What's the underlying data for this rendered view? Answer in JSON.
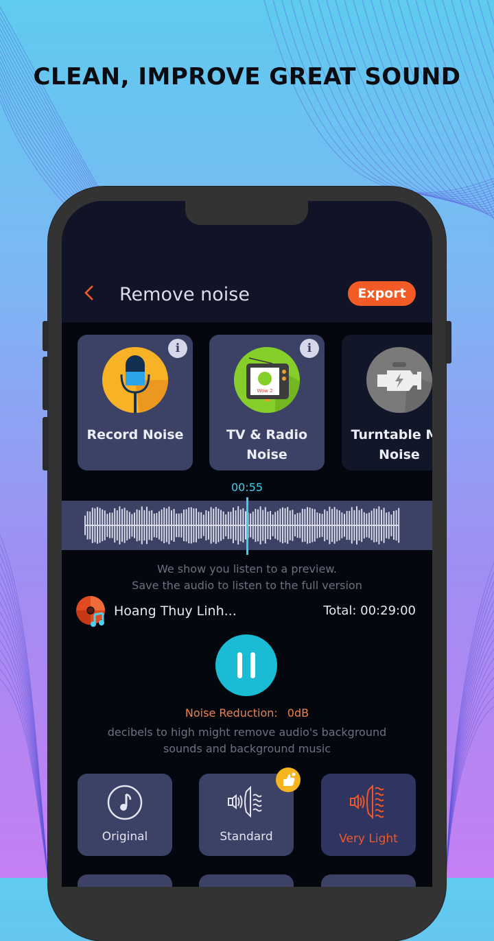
{
  "promo": {
    "headline": "CLEAN, IMPROVE GREAT SOUND"
  },
  "header": {
    "title": "Remove noise",
    "back_icon": "chevron-left-icon",
    "export_label": "Export"
  },
  "noise_types": [
    {
      "label": "Record Noise",
      "icon": "microphone-icon",
      "has_info": true
    },
    {
      "label": "TV & Radio\nNoise",
      "icon": "tv-icon",
      "has_info": true
    },
    {
      "label": "Turntable Mo\nNoise",
      "icon": "engine-icon",
      "has_info": false
    }
  ],
  "player": {
    "current_time": "00:55",
    "preview_hint_line1": "We show you listen to a preview.",
    "preview_hint_line2": "Save the audio to listen to the full version",
    "track_name": "Hoang Thuy Linh...",
    "total_label": "Total: 00:29:00",
    "pause_icon": "pause-icon",
    "progress_fraction": 0.5
  },
  "noise_reduction": {
    "label": "Noise Reduction:",
    "value": "0dB",
    "note": "decibels to high might remove audio's background sounds and background music"
  },
  "modes": [
    {
      "label": "Original",
      "icon": "music-note-icon",
      "selected": false
    },
    {
      "label": "Standard",
      "icon": "speaker-waves-icon",
      "selected": false,
      "recommended": true
    },
    {
      "label": "Very Light",
      "icon": "speaker-waves-icon",
      "selected": true
    }
  ],
  "colors": {
    "accent_orange": "#f25a26",
    "accent_cyan": "#3fd0f0",
    "card_bg": "#3c4166",
    "screen_bg": "#05070f",
    "badge_yellow": "#f6b41f"
  }
}
